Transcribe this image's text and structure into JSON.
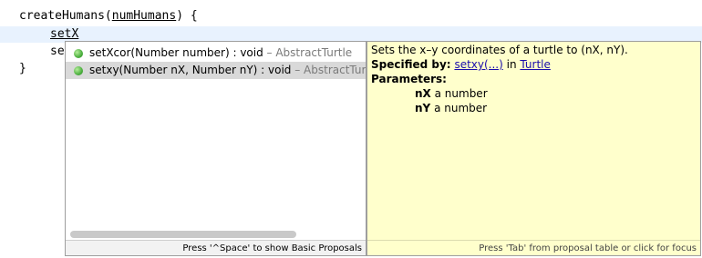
{
  "editor": {
    "line1": {
      "prefix": "createHumans(",
      "param": "numHumans",
      "suffix": ") {"
    },
    "line2": {
      "text": "setX"
    },
    "line3": {
      "text": "se"
    },
    "line4": {
      "text": "}"
    }
  },
  "proposals": {
    "items": [
      {
        "name": "setXcor(Number number) : void",
        "type": " – AbstractTurtle",
        "selected": false,
        "icon": "public-method-icon"
      },
      {
        "name": "setxy(Number nX, Number nY) : void",
        "type": " – AbstractTurtle",
        "selected": true,
        "icon": "public-method-icon"
      }
    ],
    "status": "Press '^Space' to show Basic Proposals"
  },
  "docs": {
    "summary": "Sets the x–y coordinates of a turtle to (nX, nY).",
    "specified_label": "Specified by:",
    "specified_method": "setxy(...)",
    "specified_in": "in",
    "specified_class": "Turtle",
    "parameters_label": "Parameters:",
    "params": [
      {
        "name": "nX",
        "desc": "a number"
      },
      {
        "name": "nY",
        "desc": "a number"
      }
    ],
    "status": "Press 'Tab' from proposal table or click for focus"
  }
}
